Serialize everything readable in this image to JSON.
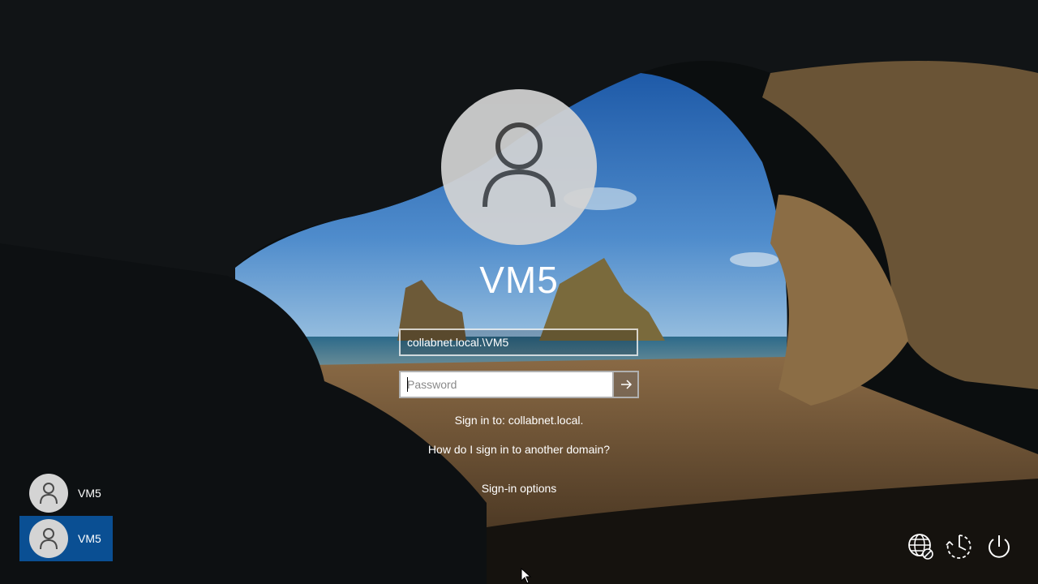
{
  "login": {
    "display_name": "VM5",
    "username_value": "collabnet.local.\\VM5",
    "password_placeholder": "Password",
    "sign_in_to": "Sign in to: collabnet.local.",
    "other_domain_link": "How do I sign in to another domain?",
    "sign_in_options": "Sign-in options"
  },
  "user_list": [
    {
      "label": "VM5",
      "selected": false
    },
    {
      "label": "VM5",
      "selected": true
    }
  ],
  "system_icons": [
    "network-icon",
    "ease-of-access-icon",
    "power-icon"
  ],
  "colors": {
    "selected_tile": "#0a5aaa",
    "text": "#ffffff",
    "avatar": "#d4d4d4"
  }
}
